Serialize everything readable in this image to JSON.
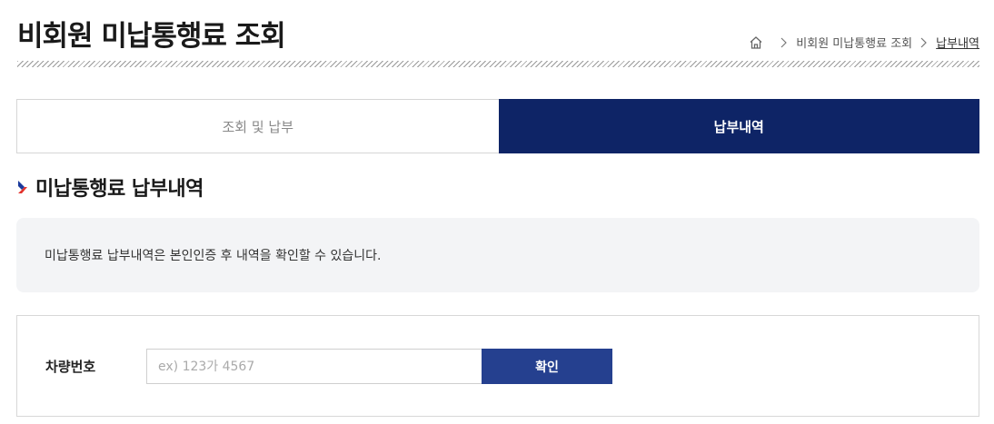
{
  "header": {
    "title": "비회원 미납통행료 조회",
    "breadcrumb": {
      "home_icon": "home-icon",
      "items": [
        "비회원 미납통행료 조회",
        "납부내역"
      ]
    }
  },
  "tabs": [
    {
      "label": "조회 및 납부",
      "active": false
    },
    {
      "label": "납부내역",
      "active": true
    }
  ],
  "section": {
    "heading": "미납통행료 납부내역",
    "icon": "chevron-right-icon"
  },
  "info": {
    "text": "미납통행료 납부내역은 본인인증 후 내역을 확인할 수 있습니다."
  },
  "form": {
    "label": "차량번호",
    "input_value": "",
    "input_placeholder": "ex) 123가 4567",
    "button_label": "확인"
  },
  "colors": {
    "tab_active_bg": "#0e2466",
    "button_bg": "#25408f",
    "info_bg": "#f3f4f6",
    "chevron_blue": "#1a3a9c",
    "chevron_red": "#e2332d"
  }
}
